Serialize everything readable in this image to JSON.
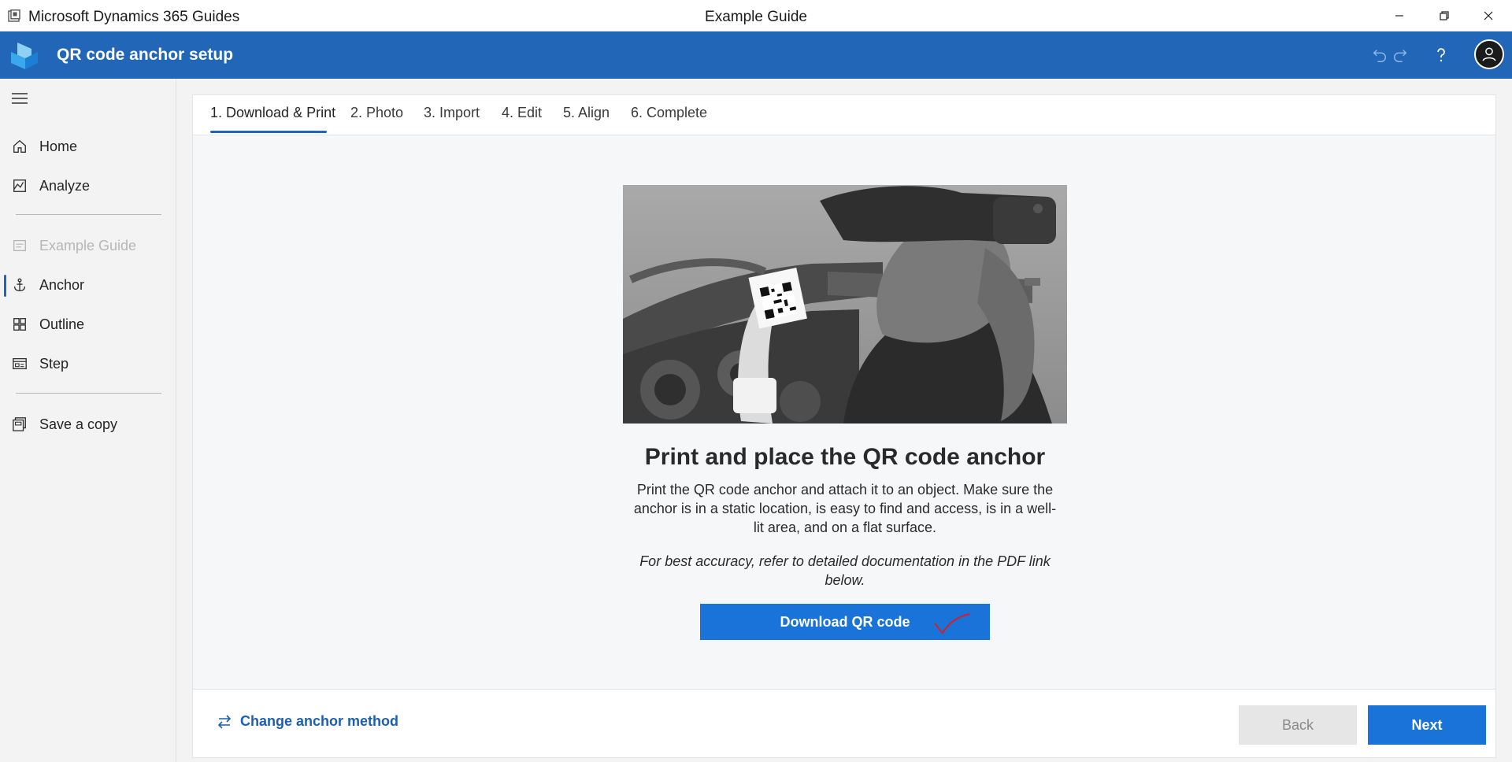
{
  "window": {
    "app_name": "Microsoft Dynamics 365 Guides",
    "document_title": "Example Guide"
  },
  "header": {
    "page_title": "QR code anchor setup",
    "icons": [
      "undo-icon",
      "redo-icon",
      "help-icon",
      "user-avatar-icon"
    ]
  },
  "sidebar": {
    "items": [
      {
        "label": "Home",
        "icon": "home-icon"
      },
      {
        "label": "Analyze",
        "icon": "analyze-icon"
      },
      {
        "label": "Example Guide",
        "icon": "guide-icon",
        "disabled": true
      },
      {
        "label": "Anchor",
        "icon": "anchor-icon",
        "selected": true
      },
      {
        "label": "Outline",
        "icon": "outline-icon"
      },
      {
        "label": "Step",
        "icon": "step-icon"
      },
      {
        "label": "Save a copy",
        "icon": "save-copy-icon"
      }
    ]
  },
  "tabs": [
    {
      "label": "1. Download & Print",
      "active": true
    },
    {
      "label": "2. Photo"
    },
    {
      "label": "3. Import"
    },
    {
      "label": "4. Edit"
    },
    {
      "label": "5. Align"
    },
    {
      "label": "6. Complete"
    }
  ],
  "content": {
    "heading": "Print and place the QR code anchor",
    "description": "Print the QR code anchor and attach it to an object. Make sure the anchor is in a static location, is easy to find and access, is in a well-lit area, and on a flat surface.",
    "note": "For best accuracy, refer to detailed documentation in the PDF link below.",
    "download_button": "Download QR code"
  },
  "footer": {
    "change_method_link": "Change anchor method",
    "back_button": "Back",
    "next_button": "Next"
  },
  "colors": {
    "brand_blue": "#2266b7",
    "primary_button": "#1a73d9",
    "check_mark": "#d21f2b"
  }
}
